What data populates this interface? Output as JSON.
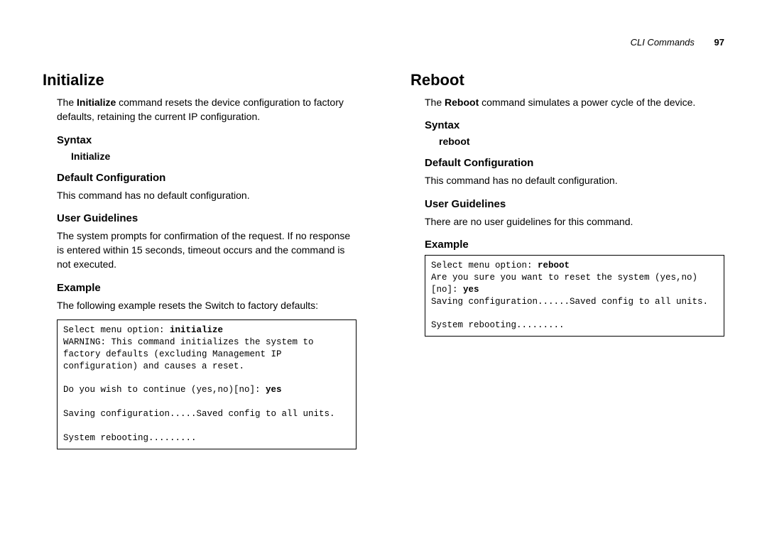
{
  "header": {
    "title": "CLI Commands",
    "page_number": "97"
  },
  "left": {
    "title": "Initialize",
    "intro_pre": "The ",
    "intro_cmd": "Initialize",
    "intro_post": " command resets the device configuration to factory defaults, retaining the current IP configuration.",
    "syntax_heading": "Syntax",
    "syntax_word": "Initialize",
    "defconf_heading": "Default Configuration",
    "defconf_text": "This command has no default configuration.",
    "userg_heading": "User Guidelines",
    "userg_text": "The system prompts for confirmation of the request. If no response is entered within 15 seconds, timeout occurs and the command is not executed.",
    "example_heading": "Example",
    "example_text": "The following example resets the Switch to factory defaults:",
    "code": {
      "l1a": "Select menu option: ",
      "l1b": "initialize",
      "l2": "WARNING: This command initializes the system to factory defaults (excluding Management IP configuration) and causes a reset.",
      "l3a": "Do you wish to continue (yes,no)[no]: ",
      "l3b": "yes",
      "l4": "Saving configuration.....Saved config to all units.",
      "l5": "System rebooting........."
    }
  },
  "right": {
    "title": "Reboot",
    "intro_pre": "The ",
    "intro_cmd": "Reboot",
    "intro_post": " command simulates a power cycle of the device.",
    "syntax_heading": "Syntax",
    "syntax_word": "reboot",
    "defconf_heading": "Default Configuration",
    "defconf_text": "This command has no default configuration.",
    "userg_heading": "User Guidelines",
    "userg_text": "There are no user guidelines for this command.",
    "example_heading": "Example",
    "code": {
      "l1a": "Select menu option: ",
      "l1b": "reboot",
      "l2a": "Are you sure you want to reset the system (yes,no)[no]: ",
      "l2b": "yes",
      "l3": "Saving configuration......Saved config to all units.",
      "l4": "System rebooting........."
    }
  }
}
